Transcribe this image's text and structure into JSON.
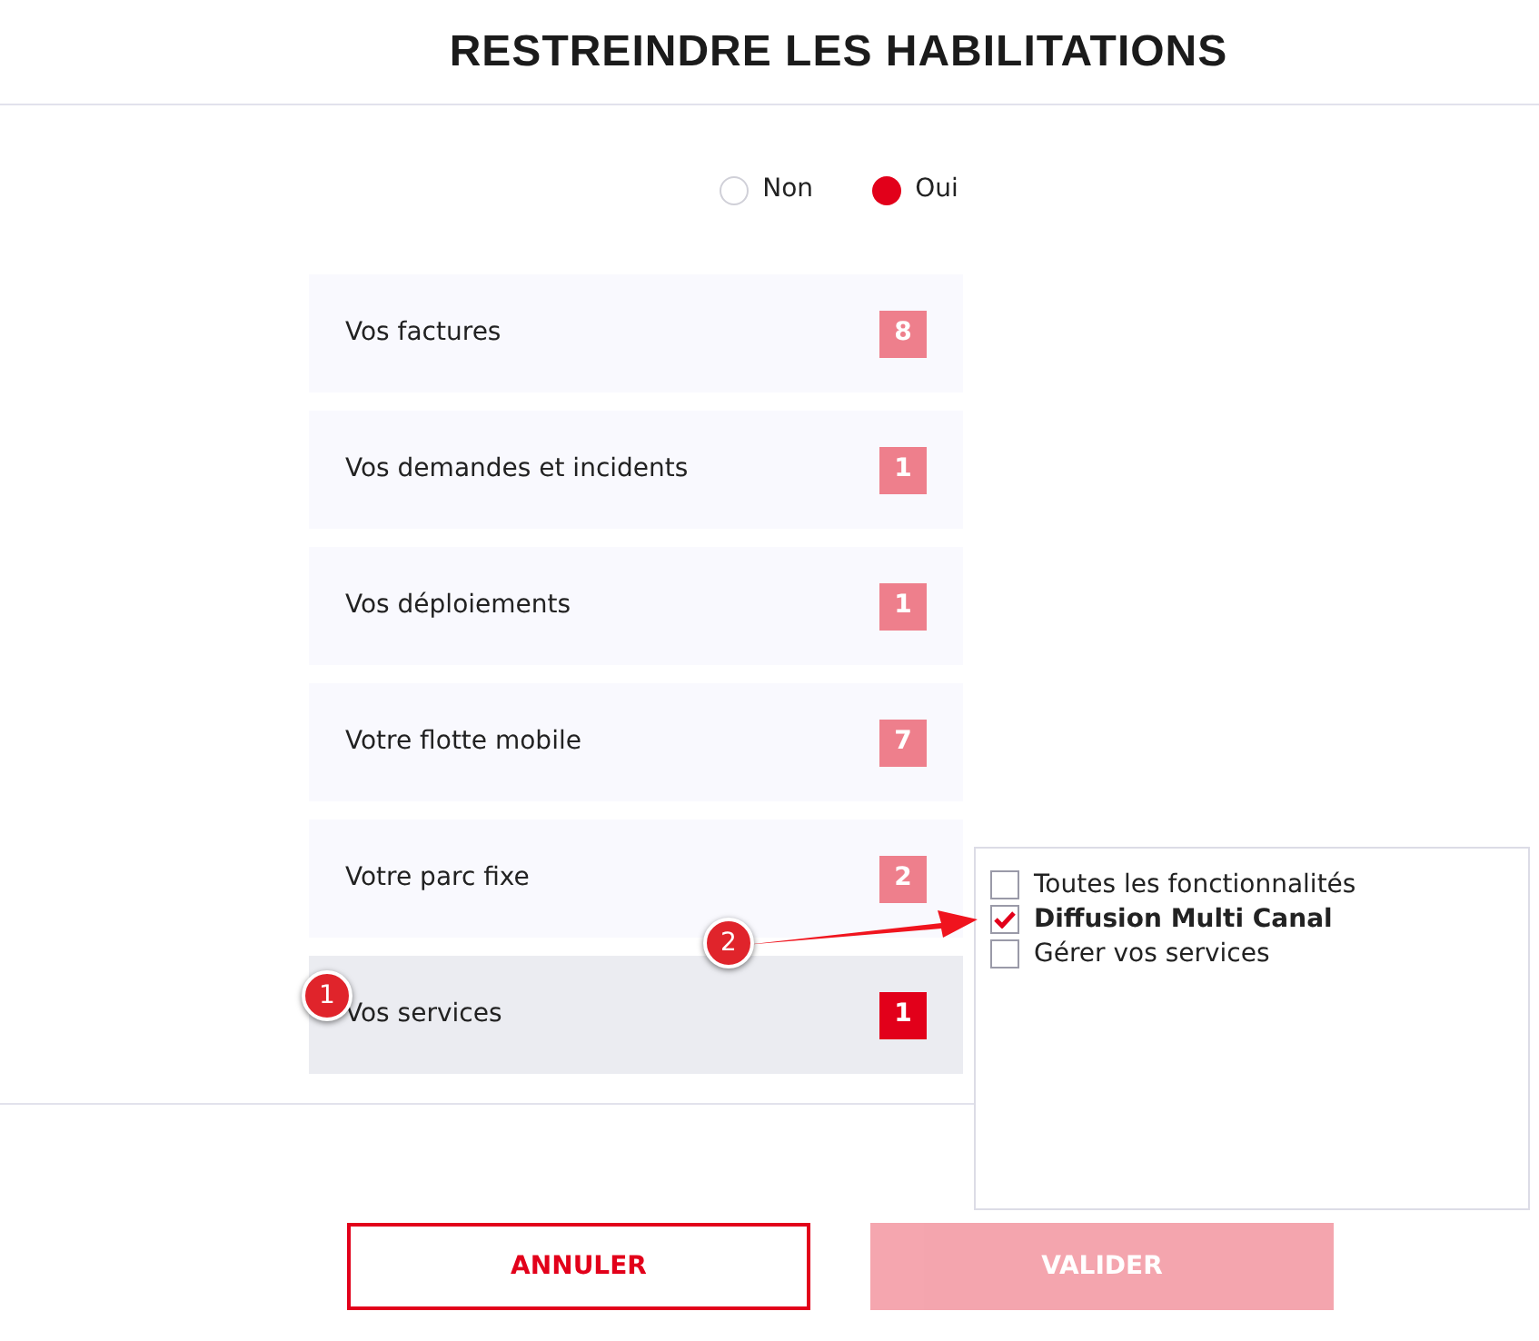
{
  "title": "RESTREINDRE LES HABILITATIONS",
  "radios": [
    {
      "label": "Non",
      "selected": false
    },
    {
      "label": "Oui",
      "selected": true
    }
  ],
  "categories": [
    {
      "label": "Vos factures",
      "count": "8",
      "selected": false
    },
    {
      "label": "Vos demandes et incidents",
      "count": "1",
      "selected": false
    },
    {
      "label": "Vos déploiements",
      "count": "1",
      "selected": false
    },
    {
      "label": "Votre flotte mobile",
      "count": "7",
      "selected": false
    },
    {
      "label": "Votre parc fixe",
      "count": "2",
      "selected": false
    },
    {
      "label": "Vos services",
      "count": "1",
      "selected": true
    }
  ],
  "options": [
    {
      "label": "Toutes les fonctionnalités",
      "checked": false
    },
    {
      "label": "Diffusion Multi Canal",
      "checked": true
    },
    {
      "label": "Gérer vos services",
      "checked": false
    }
  ],
  "annotations": [
    {
      "label": "1"
    },
    {
      "label": "2"
    }
  ],
  "buttons": [
    {
      "label": "ANNULER",
      "kind": "outline",
      "disabled": false
    },
    {
      "label": "VALIDER",
      "kind": "filled",
      "disabled": true
    }
  ]
}
